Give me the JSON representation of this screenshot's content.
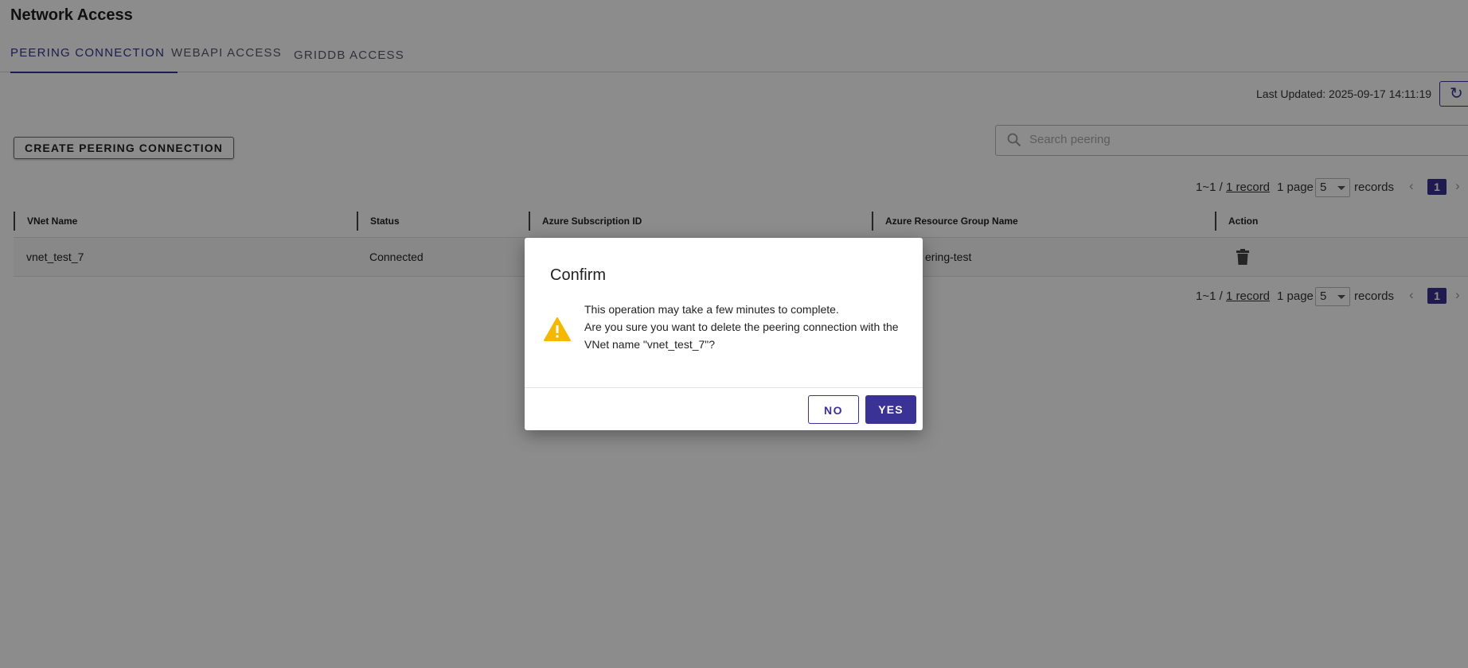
{
  "page": {
    "title": "Network Access"
  },
  "tabs": [
    {
      "label": "PEERING CONNECTION",
      "active": true
    },
    {
      "label": "WEBAPI ACCESS",
      "active": false
    },
    {
      "label": "GRIDDB ACCESS",
      "active": false
    }
  ],
  "toolbar": {
    "last_updated": "Last Updated: 2025-09-17 14:11:19",
    "refresh_icon": "refresh-icon",
    "create_label": "CREATE PEERING CONNECTION",
    "search_placeholder": "Search peering",
    "search_icon": "search-icon"
  },
  "pager": {
    "range": "1~1 /",
    "record_link": "1 record",
    "pages": "1 page",
    "page_size": "5",
    "records_label": "records",
    "current_page": "1"
  },
  "table": {
    "columns": [
      "VNet Name",
      "Status",
      "Azure Subscription ID",
      "Azure Resource Group Name",
      "Action"
    ],
    "rows": [
      {
        "vnet_name": "vnet_test_7",
        "status": "Connected",
        "subscription_id": "",
        "resource_group": "ering-test",
        "action_icon": "trash-icon"
      }
    ]
  },
  "dialog": {
    "title": "Confirm",
    "icon": "warning-icon",
    "line1": "This operation may take a few minutes to complete.",
    "line2": "Are you sure you want to delete the peering connection with the VNet name \"vnet_test_7\"?",
    "no_label": "NO",
    "yes_label": "YES"
  },
  "colors": {
    "accent": "#3a3294",
    "warning": "#f5b800",
    "overlay": "rgba(0,0,0,0.45)"
  }
}
